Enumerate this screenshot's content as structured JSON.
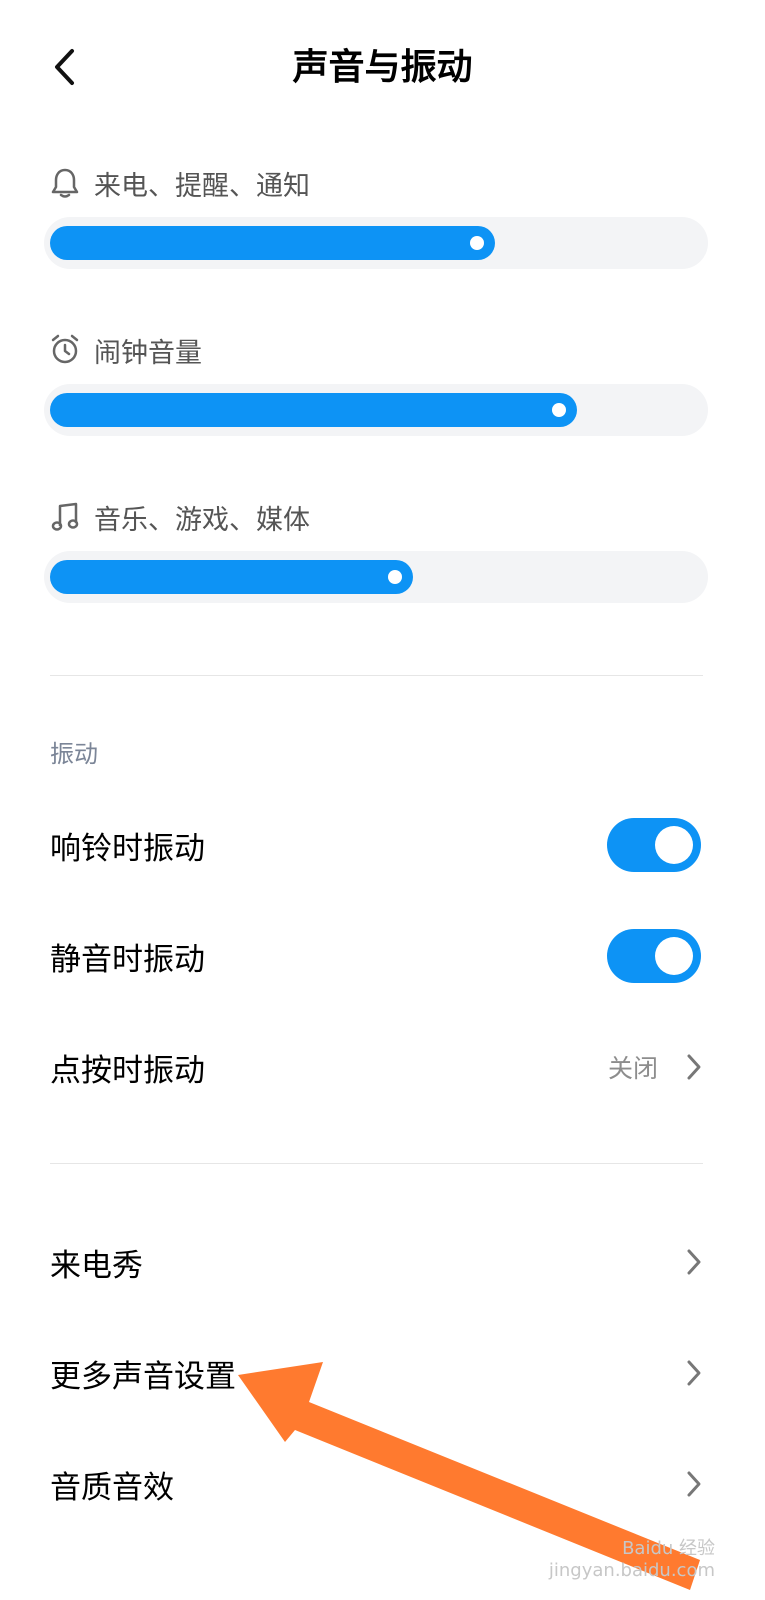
{
  "header": {
    "title": "声音与振动"
  },
  "volumes": [
    {
      "label": "来电、提醒、通知",
      "icon": "bell-icon",
      "level": 0.68
    },
    {
      "label": "闹钟音量",
      "icon": "alarm-clock-icon",
      "level": 0.8
    },
    {
      "label": "音乐、游戏、媒体",
      "icon": "music-note-icon",
      "level": 0.55
    }
  ],
  "vibration": {
    "section_title": "振动",
    "ring": {
      "label": "响铃时振动",
      "on": true
    },
    "silent": {
      "label": "静音时振动",
      "on": true
    },
    "tap": {
      "label": "点按时振动",
      "value": "关闭"
    }
  },
  "more": {
    "caller_show": "来电秀",
    "more_sound": "更多声音设置",
    "sound_effects": "音质音效"
  },
  "watermark": {
    "line1": "Baidu 经验",
    "line2": "jingyan.baidu.com"
  },
  "colors": {
    "accent": "#0d93f5",
    "arrow": "#ff7a2f",
    "track": "#f3f4f6"
  }
}
